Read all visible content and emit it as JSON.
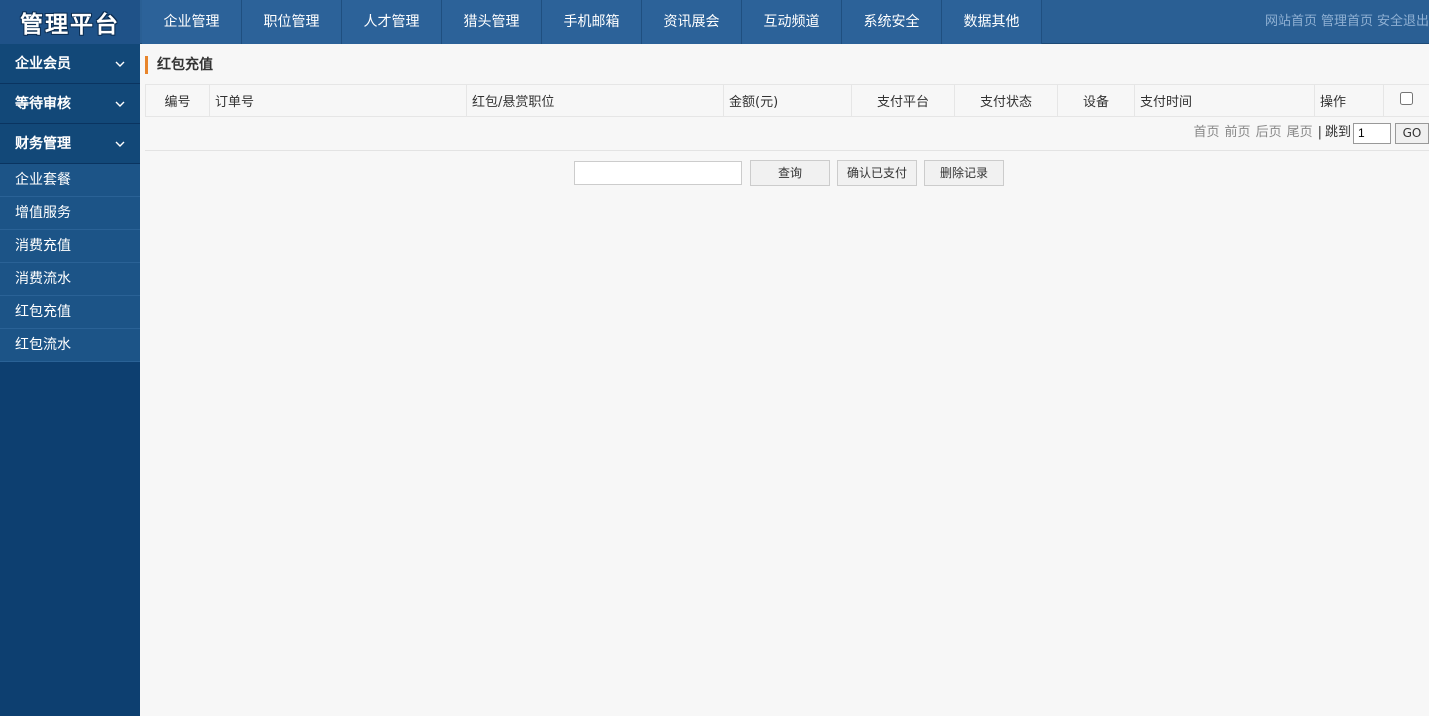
{
  "logo": {
    "text": "管理平台"
  },
  "nav": {
    "items": [
      {
        "label": "企业管理"
      },
      {
        "label": "职位管理"
      },
      {
        "label": "人才管理"
      },
      {
        "label": "猎头管理"
      },
      {
        "label": "手机邮箱"
      },
      {
        "label": "资讯展会"
      },
      {
        "label": "互动频道"
      },
      {
        "label": "系统安全"
      },
      {
        "label": "数据其他"
      }
    ]
  },
  "top_links": {
    "site_home": "网站首页",
    "admin_home": "管理首页",
    "logout": "安全退出"
  },
  "sidebar": {
    "groups": [
      {
        "label": "企业会员"
      },
      {
        "label": "等待审核"
      },
      {
        "label": "财务管理"
      }
    ],
    "sub_items": [
      {
        "label": "企业套餐"
      },
      {
        "label": "增值服务"
      },
      {
        "label": "消费充值"
      },
      {
        "label": "消费流水"
      },
      {
        "label": "红包充值"
      },
      {
        "label": "红包流水"
      }
    ]
  },
  "main": {
    "title": "红包充值",
    "table": {
      "headers": [
        "编号",
        "订单号",
        "红包/悬赏职位",
        "金额(元)",
        "支付平台",
        "支付状态",
        "设备",
        "支付时间",
        "操作"
      ],
      "select_all_checked": false
    },
    "pager": {
      "first": "首页",
      "prev": "前页",
      "next": "后页",
      "last": "尾页",
      "separator": "|",
      "jump_label": "跳到",
      "page_value": "1",
      "go_label": "GO"
    },
    "search": {
      "value": "",
      "query_button": "查询",
      "confirm_paid_button": "确认已支付",
      "delete_button": "删除记录"
    }
  }
}
